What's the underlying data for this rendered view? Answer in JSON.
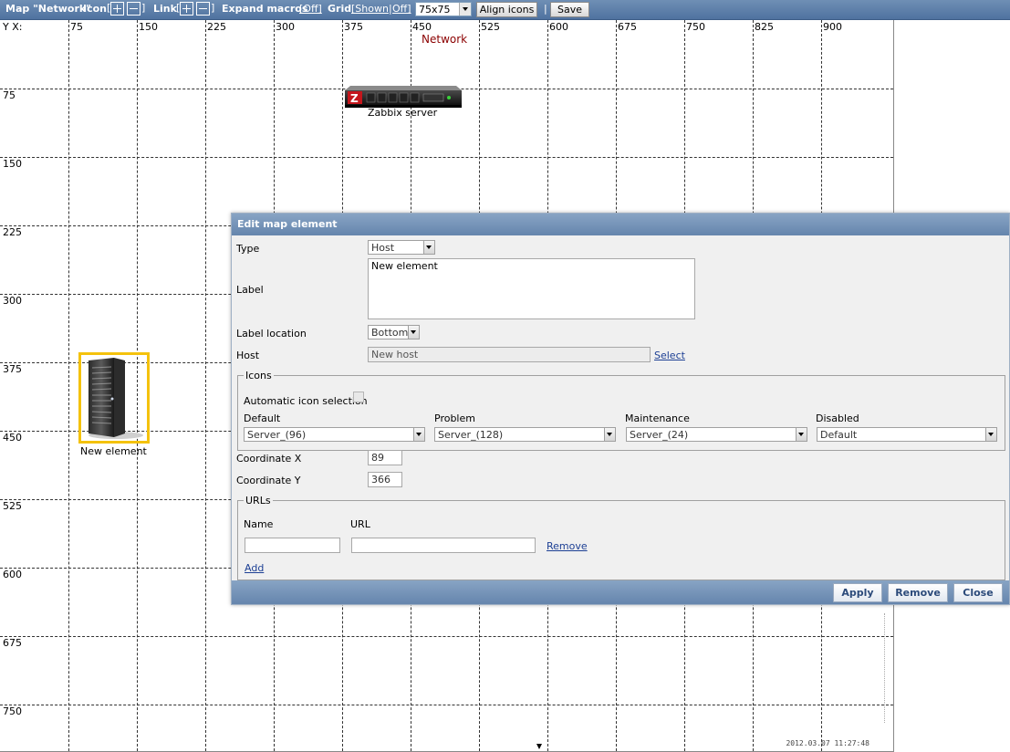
{
  "toolbar": {
    "map_title": "Map \"Network\"",
    "icon_label": "Icon",
    "link_label": "Link",
    "expand_macros_label": "Expand macros",
    "expand_macros_value": "[Off]",
    "grid_label": "Grid",
    "grid_shown": "[Shown",
    "grid_sep": "|",
    "grid_off": "Off]",
    "grid_size": "75x75",
    "align_icons": "Align icons",
    "separator": "|",
    "save": "Save"
  },
  "map": {
    "axis_corner": "Y X:",
    "title": "Network",
    "x_ticks": [
      "75",
      "150",
      "225",
      "300",
      "375",
      "450",
      "525",
      "600",
      "675",
      "750",
      "825",
      "900"
    ],
    "y_ticks": [
      "75",
      "150",
      "225",
      "300",
      "375",
      "450",
      "525",
      "600",
      "675",
      "750"
    ],
    "elements": [
      {
        "label": "Zabbix server",
        "icon": "server-rack-icon"
      },
      {
        "label": "New element",
        "icon": "server-tower-icon",
        "selected": true
      }
    ],
    "timestamp": "2012.03.07 11:27:48",
    "selection_color": "#f4c20d",
    "title_color": "#8b0000"
  },
  "dialog": {
    "title": "Edit map element",
    "type_label": "Type",
    "type_value": "Host",
    "label_label": "Label",
    "label_value": "New element",
    "label_location_label": "Label location",
    "label_location_value": "Bottom",
    "host_label": "Host",
    "host_value": "New host",
    "select_link": "Select",
    "icons_legend": "Icons",
    "auto_icon_label": "Automatic icon selection",
    "default_label": "Default",
    "default_value": "Server_(96)",
    "problem_label": "Problem",
    "problem_value": "Server_(128)",
    "maintenance_label": "Maintenance",
    "maintenance_value": "Server_(24)",
    "disabled_label": "Disabled",
    "disabled_value": "Default",
    "coord_x_label": "Coordinate X",
    "coord_x_value": "89",
    "coord_y_label": "Coordinate Y",
    "coord_y_value": "366",
    "urls_legend": "URLs",
    "name_col": "Name",
    "url_col": "URL",
    "name_value": "",
    "url_value": "",
    "remove_link": "Remove",
    "add_link": "Add",
    "apply_button": "Apply",
    "remove_button": "Remove",
    "close_button": "Close"
  }
}
